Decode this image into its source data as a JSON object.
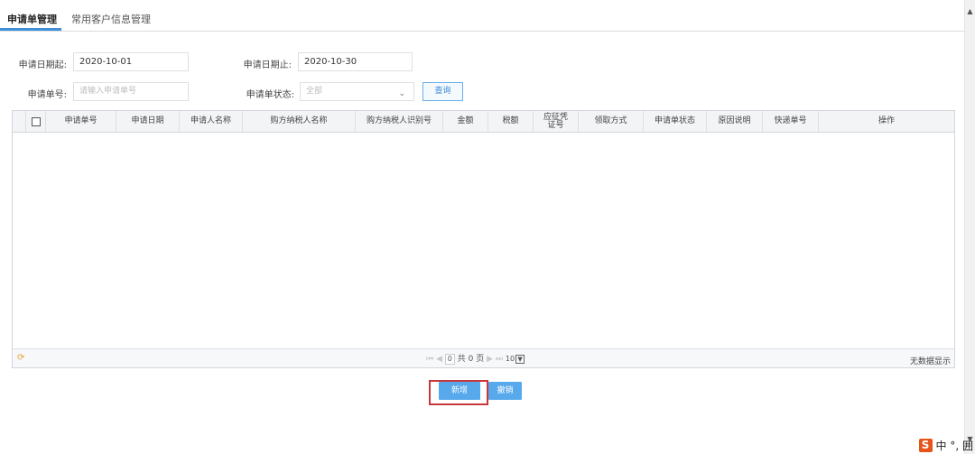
{
  "tabs": [
    {
      "label": "申请单管理",
      "active": true
    },
    {
      "label": "常用客户信息管理",
      "active": false
    }
  ],
  "form": {
    "date_start_label": "申请日期起:",
    "date_start_value": "2020-10-01",
    "date_end_label": "申请日期止:",
    "date_end_value": "2020-10-30",
    "order_no_label": "申请单号:",
    "order_no_placeholder": "请输入申请单号",
    "status_label": "申请单状态:",
    "status_value": "全部",
    "query_label": "查询"
  },
  "grid": {
    "columns": [
      "申请单号",
      "申请日期",
      "申请人名称",
      "购方纳税人名称",
      "购方纳税人识别号",
      "金额",
      "税额",
      "应征凭证号",
      "领取方式",
      "申请单状态",
      "原因说明",
      "快递单号",
      "操作"
    ],
    "rows": [],
    "pager": {
      "page_input": "0",
      "total_text": "共 0 页",
      "page_size": "10",
      "no_data": "无数据显示"
    }
  },
  "actions": {
    "add_label": "新增",
    "revoke_label": "撤销"
  },
  "ime": {
    "logo": "S",
    "text": "中 °, 囲"
  },
  "colors": {
    "accent": "#3e8ed8",
    "button": "#58a9ec",
    "highlight": "#c8373a"
  }
}
